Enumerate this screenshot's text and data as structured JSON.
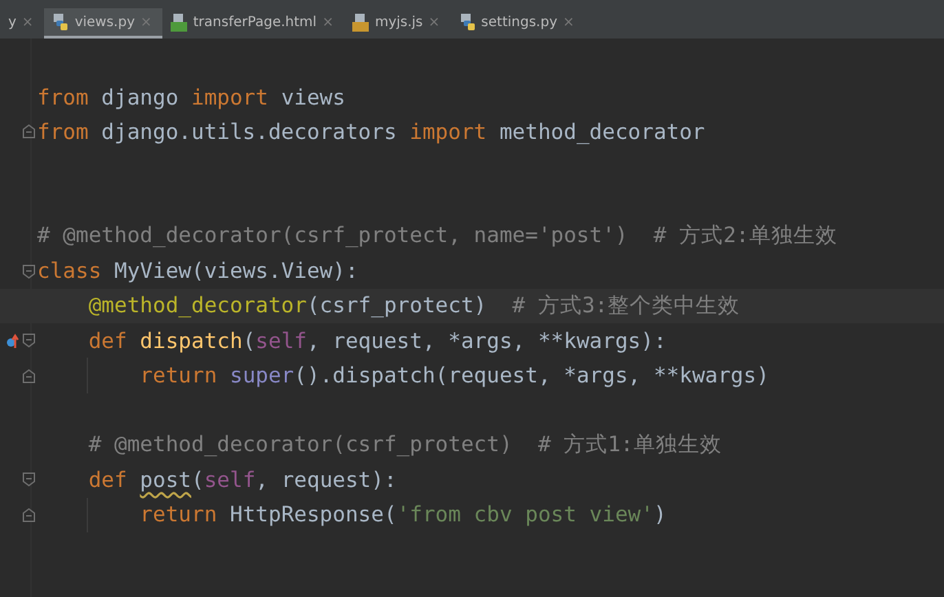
{
  "tabs": [
    {
      "label": "y",
      "kind": "cut",
      "selected": false,
      "close": "×"
    },
    {
      "label": "views.py",
      "kind": "python",
      "selected": true,
      "close": "×"
    },
    {
      "label": "transferPage.html",
      "kind": "html",
      "selected": false,
      "close": "×"
    },
    {
      "label": "myjs.js",
      "kind": "js",
      "selected": false,
      "close": "×"
    },
    {
      "label": "settings.py",
      "kind": "python",
      "selected": false,
      "close": "×"
    }
  ],
  "editor": {
    "lines": [
      {
        "tokens": [
          {
            "kind": "kw",
            "text": "from"
          },
          {
            "kind": "plain",
            "text": " django "
          },
          {
            "kind": "kw",
            "text": "import"
          },
          {
            "kind": "plain",
            "text": " views"
          }
        ]
      },
      {
        "kind": "fold-end",
        "tokens": [
          {
            "kind": "kw",
            "text": "from"
          },
          {
            "kind": "plain",
            "text": " django.utils.decorators "
          },
          {
            "kind": "kw",
            "text": "import"
          },
          {
            "kind": "plain",
            "text": " method_decorator"
          }
        ]
      },
      {
        "kind": "blank"
      },
      {
        "kind": "blank"
      },
      {
        "tokens": [
          {
            "kind": "comment",
            "text": "# @method_decorator(csrf_protect, name='post')  # 方式2:单独生效"
          }
        ]
      },
      {
        "kind": "fold-start",
        "tokens": [
          {
            "kind": "kw",
            "text": "class"
          },
          {
            "kind": "plain",
            "text": " MyView(views.View):"
          }
        ]
      },
      {
        "current": true,
        "tokens": [
          {
            "kind": "deco",
            "text": "    @method_decorator"
          },
          {
            "kind": "plain",
            "text": "(csrf_protect)  "
          },
          {
            "kind": "comment",
            "text": "# 方式3:整个类中生效"
          }
        ]
      },
      {
        "kind": "fold-start",
        "override": true,
        "tokens": [
          {
            "kind": "kw",
            "text": "    def "
          },
          {
            "kind": "fn",
            "text": "dispatch"
          },
          {
            "kind": "plain",
            "text": "("
          },
          {
            "kind": "self",
            "text": "self"
          },
          {
            "kind": "plain",
            "text": ", request, *args, **kwargs):"
          }
        ]
      },
      {
        "kind": "fold-end",
        "tokens": [
          {
            "kind": "kw",
            "text": "        return "
          },
          {
            "kind": "builtin",
            "text": "super"
          },
          {
            "kind": "plain",
            "text": "().dispatch(request, *args, **kwargs)"
          }
        ]
      },
      {
        "kind": "blank"
      },
      {
        "tokens": [
          {
            "kind": "comment",
            "text": "    # @method_decorator(csrf_protect)  # 方式1:单独生效"
          }
        ]
      },
      {
        "kind": "fold-start",
        "tokens": [
          {
            "kind": "kw",
            "text": "    def "
          },
          {
            "kind": "warn",
            "text": "post"
          },
          {
            "kind": "plain",
            "text": "("
          },
          {
            "kind": "self",
            "text": "self"
          },
          {
            "kind": "plain",
            "text": ", request):"
          }
        ]
      },
      {
        "kind": "fold-end",
        "tokens": [
          {
            "kind": "kw",
            "text": "        return"
          },
          {
            "kind": "plain",
            "text": " HttpResponse("
          },
          {
            "kind": "string",
            "text": "'from cbv post view'"
          },
          {
            "kind": "plain",
            "text": ")"
          }
        ]
      }
    ]
  }
}
